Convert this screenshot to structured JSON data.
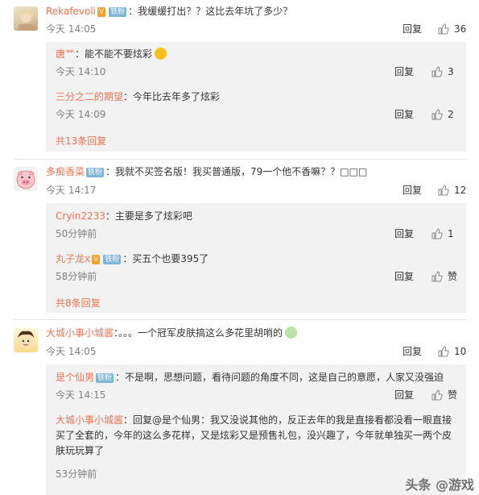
{
  "comments": [
    {
      "author": "Rekafevoli",
      "badge": "铁粉",
      "text": "：我缓缓打出？？这比去年坑了多少？",
      "time": "今天 14:05",
      "reply_label": "回复",
      "likes": "36",
      "replies": [
        {
          "author": "唐艹",
          "text": "：能不能不要炫彩",
          "time": "今天 14:10",
          "reply_label": "回复",
          "likes": "3"
        },
        {
          "author": "三分之二的期望",
          "text": "：今年比去年多了炫彩",
          "time": "今天 14:09",
          "reply_label": "回复",
          "likes": "2"
        }
      ],
      "more": "共13条回复"
    },
    {
      "author": "多痴香菜",
      "badge": "铁粉",
      "text": "：我就不买签名版！我买普通版，79一个他不香嘛？？□□□",
      "time": "今天 14:17",
      "reply_label": "回复",
      "likes": "12",
      "replies": [
        {
          "author": "Cryin2233",
          "text": "：主要是多了炫彩吧",
          "time": "50分钟前",
          "reply_label": "回复",
          "likes": "1"
        },
        {
          "author": "丸子龙x",
          "badge": "铁粉",
          "text": "：买五个也要395了",
          "time": "58分钟前",
          "reply_label": "回复",
          "likes": "赞"
        }
      ],
      "more": "共8条回复"
    },
    {
      "author": "大城小事小城酱",
      "text": "：。。。一个冠军皮肤搞这么多花里胡哨的",
      "time": "今天 14:05",
      "reply_label": "回复",
      "likes": "10",
      "replies": [
        {
          "author": "是个仙男",
          "badge": "铁粉",
          "text": "：不是啊，思想问题，看待问题的角度不同，这是自己的意愿，人家又没强迫",
          "time": "今天 14:15",
          "reply_label": "回复",
          "likes": "赞"
        },
        {
          "author": "大城小事小城酱",
          "text_line1": "：回复@是个仙男：我又没说其他的，反正去年的我是直接看都没看一眼直接",
          "text_line2": "买了全套的，今年的这么多花样，又是炫彩又是预售礼包，没兴趣了，今年就单独买一两个皮",
          "text_line3": "肤玩玩算了",
          "time": "53分钟前"
        }
      ]
    }
  ],
  "watermark": "头条 @游戏"
}
